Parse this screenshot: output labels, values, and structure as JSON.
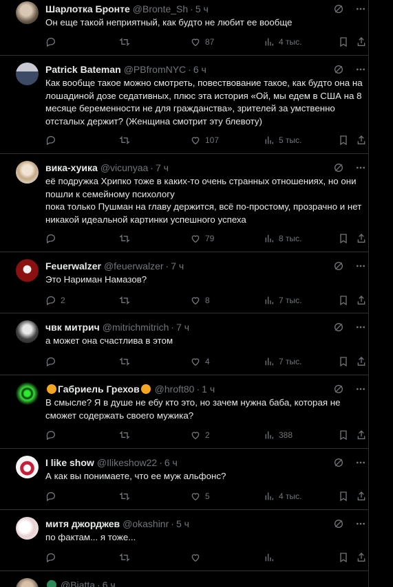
{
  "tweets": [
    {
      "name": "Шарлотка Бронте",
      "handle": "@Bronte_Sh",
      "time": "5 ч",
      "text": "Он еще такой неприятный, как будто не любит ее вообще",
      "replies": "",
      "retweets": "",
      "likes": "87",
      "views": "4 тыс."
    },
    {
      "name": "Patrick Bateman",
      "handle": "@PBfromNYC",
      "time": "6 ч",
      "text": "Как вообще такое можно смотреть, повествование такое, как будто она на лошадиной дозе седативных, плюс эта история «Ой, мы едем в США на 8 месяце беременности не для гражданства», зрителей за умственно отсталых держит? (Женщина смотрит эту блевоту)",
      "replies": "",
      "retweets": "",
      "likes": "107",
      "views": "5 тыс."
    },
    {
      "name": "вика-хуика",
      "handle": "@vicunyaa",
      "time": "7 ч",
      "text": "её подружка Хрипко тоже в каких-то очень странных отношениях, но они пошли к семейному психологу\nпока только Пушман на главу держится, всё по-простому, прозрачно и нет никакой идеальной картинки успешного успеха",
      "replies": "",
      "retweets": "",
      "likes": "79",
      "views": "8 тыс."
    },
    {
      "name": "Feuerwalzer",
      "handle": "@feuerwalzer",
      "time": "7 ч",
      "text": "Это Нариман Намазов?",
      "replies": "2",
      "retweets": "",
      "likes": "8",
      "views": "7 тыс."
    },
    {
      "name": "чвк митрич",
      "handle": "@mitrichmitrich",
      "time": "7 ч",
      "text": "а может она счастлива в этом",
      "replies": "",
      "retweets": "",
      "likes": "4",
      "views": "7 тыс."
    },
    {
      "name": "Габриель Грехов",
      "handle": "@hroft80",
      "time": "1 ч",
      "text": "В смысле? Я в душе не ебу кто это, но зачем нужна баба, которая не сможет содержать своего мужика?",
      "replies": "",
      "retweets": "",
      "likes": "2",
      "views": "388"
    },
    {
      "name": "I like show",
      "handle": "@Ilikeshow22",
      "time": "6 ч",
      "text": "А как вы понимаете, что ее муж альфонс?",
      "replies": "",
      "retweets": "",
      "likes": "5",
      "views": "4 тыс."
    },
    {
      "name": "митя джорджев",
      "handle": "@okashinr",
      "time": "5 ч",
      "text": "по фактам... я тоже...",
      "replies": "",
      "retweets": "",
      "likes": "",
      "views": ""
    },
    {
      "name": "",
      "handle": "@Biatta",
      "time": "6 ч",
      "text": "",
      "replies": "",
      "retweets": "",
      "likes": "",
      "views": ""
    }
  ],
  "colors": {
    "background": "#000000",
    "text": "#e7e9ea",
    "muted": "#71767b",
    "divider": "#2f3336"
  }
}
